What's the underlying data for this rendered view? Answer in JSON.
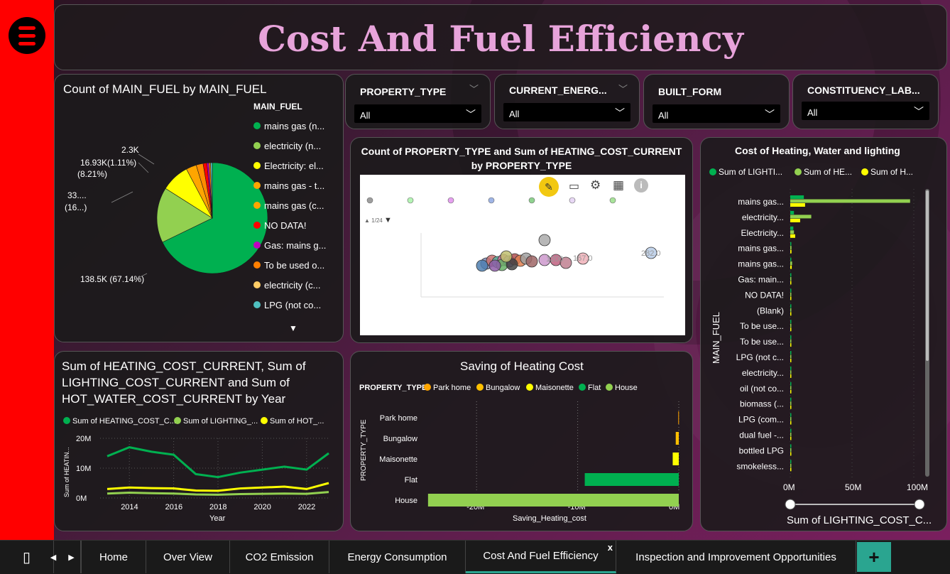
{
  "title": "Cost And Fuel Efficiency",
  "colors": {
    "accent_title": "#e7a3da",
    "sidebar": "#ff0000",
    "tab_accent": "#2aa590"
  },
  "pie": {
    "title": "Count of MAIN_FUEL by MAIN_FUEL",
    "legend_title": "MAIN_FUEL",
    "legend": [
      {
        "label": "mains gas (n...",
        "color": "#00b050"
      },
      {
        "label": "electricity (n...",
        "color": "#92d050"
      },
      {
        "label": "Electricity: el...",
        "color": "#ffff00"
      },
      {
        "label": "mains gas - t...",
        "color": "#ffa500"
      },
      {
        "label": "mains gas (c...",
        "color": "#ffa500"
      },
      {
        "label": "NO DATA!",
        "color": "#ff0000"
      },
      {
        "label": "Gas: mains g...",
        "color": "#c000c0"
      },
      {
        "label": "To be used o...",
        "color": "#ff7f00"
      },
      {
        "label": "electricity (c...",
        "color": "#ffcc66"
      },
      {
        "label": "LPG (not co...",
        "color": "#4fc0c0"
      }
    ],
    "labels": {
      "big": "138.5K (67.14%)",
      "second_a": "33....",
      "second_b": "(16...)",
      "third_a": "16.93K(1.11%)",
      "third_b": "(8.21%)",
      "fourth": "2.3K"
    },
    "slices": [
      67.14,
      16.0,
      8.21,
      3.0,
      2.0,
      1.11,
      0.54,
      0.5,
      0.5
    ],
    "slice_colors": [
      "#00b050",
      "#92d050",
      "#ffff00",
      "#ffa500",
      "#ff8c00",
      "#ff0000",
      "#c000c0",
      "#ff7f00",
      "#4fc0c0"
    ]
  },
  "slicers": [
    {
      "label": "PROPERTY_TYPE",
      "value": "All"
    },
    {
      "label": "CURRENT_ENERG...",
      "value": "All"
    },
    {
      "label": "BUILT_FORM",
      "value": "All"
    },
    {
      "label": "CONSTITUENCY_LAB...",
      "value": "All"
    }
  ],
  "scatter": {
    "title": "Count of PROPERTY_TYPE and Sum of HEATING_COST_CURRENT by PROPERTY_TYPE",
    "page": "1/24",
    "labels": [
      "1200",
      "167.0",
      "282.0"
    ]
  },
  "line": {
    "title": "Sum of HEATING_COST_CURRENT, Sum of LIGHTING_COST_CURRENT and Sum of HOT_WATER_COST_CURRENT by Year",
    "legend": [
      {
        "label": "Sum of HEATING_COST_C...",
        "color": "#00b050"
      },
      {
        "label": "Sum of LIGHTING_...",
        "color": "#92d050"
      },
      {
        "label": "Sum of HOT_...",
        "color": "#ffff00"
      }
    ],
    "ylabel": "Sum of HEATIN...",
    "xlabel": "Year",
    "yticks": [
      "20M",
      "10M",
      "0M"
    ],
    "xticks": [
      "2014",
      "2016",
      "2018",
      "2020",
      "2022"
    ]
  },
  "chart_data": [
    {
      "type": "line",
      "title": "Sum of HEATING_COST_CURRENT, Sum of LIGHTING_COST_CURRENT and Sum of HOT_WATER_COST_CURRENT by Year",
      "xlabel": "Year",
      "ylabel": "Sum of HEATIN...",
      "x": [
        2013,
        2014,
        2015,
        2016,
        2017,
        2018,
        2019,
        2020,
        2021,
        2022,
        2023
      ],
      "ylim": [
        0,
        20
      ],
      "series": [
        {
          "name": "Sum of HEATING_COST_C...",
          "color": "#00b050",
          "values": [
            14,
            17,
            15.5,
            14.5,
            8,
            7,
            8.5,
            9.5,
            10.5,
            9.5,
            15
          ]
        },
        {
          "name": "Sum of LIGHTING_...",
          "color": "#92d050",
          "values": [
            1.5,
            1.8,
            1.6,
            1.5,
            1.2,
            1.1,
            1.3,
            1.4,
            1.5,
            1.4,
            2
          ]
        },
        {
          "name": "Sum of HOT_...",
          "color": "#ffff00",
          "values": [
            3,
            3.5,
            3.3,
            3.2,
            2.5,
            2.4,
            3.2,
            3.5,
            3.8,
            3,
            5
          ]
        }
      ]
    },
    {
      "type": "bar",
      "title": "Saving of Heating Cost",
      "legend_title": "PROPERTY_TYPE",
      "legend": [
        {
          "label": "Park home",
          "color": "#ffa500"
        },
        {
          "label": "Bungalow",
          "color": "#ffc000"
        },
        {
          "label": "Maisonette",
          "color": "#ffff00"
        },
        {
          "label": "Flat",
          "color": "#00b050"
        },
        {
          "label": "House",
          "color": "#92d050"
        }
      ],
      "xlabel": "Saving_Heating_cost",
      "ylabel": "PROPERTY_TYPE",
      "categories": [
        "Park home",
        "Bungalow",
        "Maisonette",
        "Flat",
        "House"
      ],
      "values": [
        -0.05,
        -0.3,
        -0.6,
        -9.3,
        -24.8
      ],
      "colors": [
        "#ffa500",
        "#ffc000",
        "#ffff00",
        "#00b050",
        "#92d050"
      ],
      "xlim": [
        -25,
        0
      ],
      "xticks": [
        "-20M",
        "-10M",
        "0M"
      ]
    },
    {
      "type": "bar",
      "title": "Cost of Heating, Water and lighting",
      "legend": [
        {
          "label": "Sum of LIGHTI...",
          "color": "#00b050"
        },
        {
          "label": "Sum of HE...",
          "color": "#92d050"
        },
        {
          "label": "Sum of H...",
          "color": "#ffff00"
        }
      ],
      "ylabel": "MAIN_FUEL",
      "xlabel": "Sum of LIGHTING_COST_C...",
      "xticks": [
        "0M",
        "50M",
        "100M"
      ],
      "xlim": [
        0,
        100
      ],
      "categories": [
        "mains gas...",
        "electricity...",
        "Electricity...",
        "mains gas...",
        "mains gas...",
        "Gas: main...",
        "NO DATA!",
        "(Blank)",
        "To be use...",
        "To be use...",
        "LPG (not c...",
        "electricity...",
        "oil (not co...",
        "biomass (...",
        "LPG (com...",
        "dual fuel -...",
        "bottled LPG",
        "smokeless..."
      ],
      "series": [
        {
          "name": "Sum of LIGHTI...",
          "color": "#00b050",
          "values": [
            11,
            3,
            2.5,
            0.5,
            0.5,
            0.4,
            0.3,
            0.2,
            0.2,
            0.2,
            0.2,
            0.2,
            0.2,
            0.2,
            0.2,
            0.2,
            0.2,
            0.2
          ]
        },
        {
          "name": "Sum of HE...",
          "color": "#92d050",
          "values": [
            97,
            17,
            3,
            1,
            1.5,
            0.5,
            0.5,
            0.3,
            0.3,
            0.3,
            0.3,
            0.3,
            0.3,
            0.3,
            0.3,
            0.3,
            0.3,
            0.3
          ]
        },
        {
          "name": "Sum of H...",
          "color": "#ffff00",
          "values": [
            12,
            8,
            4,
            1,
            1.2,
            0.3,
            0.3,
            0.2,
            0.2,
            0.2,
            0.2,
            0.2,
            0.2,
            0.2,
            0.2,
            0.2,
            0.2,
            0.2
          ]
        }
      ]
    }
  ],
  "tabs": {
    "items": [
      "Home",
      "Over View",
      "CO2 Emission",
      "Energy Consumption",
      "Cost And Fuel Efficiency",
      "Inspection and Improvement Opportunities"
    ],
    "active_index": 4,
    "close": "x",
    "add": "+"
  }
}
